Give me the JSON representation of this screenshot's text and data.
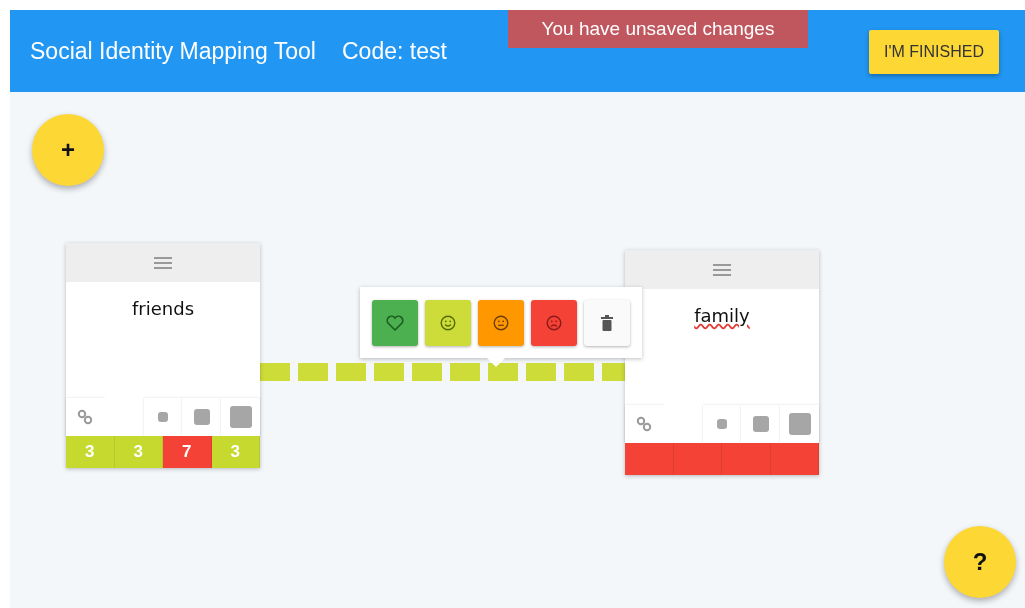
{
  "header": {
    "title": "Social Identity Mapping Tool",
    "code": "Code: test",
    "banner": "You have unsaved changes",
    "finish_button": "I'M FINISHED"
  },
  "add_button": "+",
  "help_button": "?",
  "cards": [
    {
      "name": "friends",
      "misspelled": false,
      "ratings": [
        {
          "value": "3",
          "color": "#c6d92f"
        },
        {
          "value": "3",
          "color": "#c6d92f"
        },
        {
          "value": "7",
          "color": "#f44336"
        },
        {
          "value": "3",
          "color": "#c6d92f"
        }
      ]
    },
    {
      "name": "family",
      "misspelled": true,
      "ratings": [
        {
          "color": "#f44336"
        },
        {
          "color": "#f44336"
        },
        {
          "color": "#f44336"
        },
        {
          "color": "#f44336"
        }
      ]
    }
  ],
  "connection": {
    "color": "#cddc39"
  },
  "popup": {
    "options": [
      {
        "kind": "heart",
        "color": "#4caf50"
      },
      {
        "kind": "smile",
        "color": "#cddc39"
      },
      {
        "kind": "neutral",
        "color": "#ff9800"
      },
      {
        "kind": "sad",
        "color": "#f44336"
      },
      {
        "kind": "delete",
        "color": "#fafafa"
      }
    ]
  }
}
